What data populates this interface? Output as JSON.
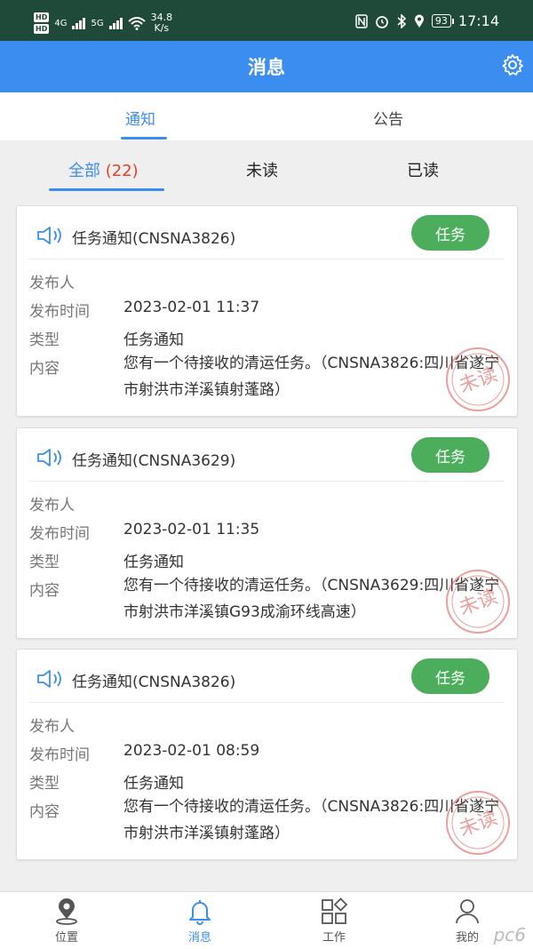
{
  "status_bar": {
    "hd1": "HD",
    "hd2": "HD",
    "net1": "4G",
    "net2": "5G",
    "speed_value": "34.8",
    "speed_unit": "K/s",
    "battery": "93",
    "time": "17:14"
  },
  "header": {
    "title": "消息",
    "settings_icon": "gear-icon"
  },
  "top_tabs": [
    {
      "label": "通知",
      "active": true
    },
    {
      "label": "公告",
      "active": false
    }
  ],
  "sub_tabs": {
    "all_label": "全部",
    "all_count": "(22)",
    "unread_label": "未读",
    "read_label": "已读"
  },
  "labels": {
    "publisher": "发布人",
    "publish_time": "发布时间",
    "type": "类型",
    "content": "内容"
  },
  "cards": [
    {
      "title": "任务通知(CNSNA3826)",
      "badge": "任务",
      "publisher": "",
      "time": "2023-02-01 11:37",
      "type": "任务通知",
      "content": "您有一个待接收的清运任务。（CNSNA3826:四川省遂宁市射洪市洋溪镇射蓬路）",
      "stamp": "未读"
    },
    {
      "title": "任务通知(CNSNA3629)",
      "badge": "任务",
      "publisher": "",
      "time": "2023-02-01 11:35",
      "type": "任务通知",
      "content": "您有一个待接收的清运任务。（CNSNA3629:四川省遂宁市射洪市洋溪镇G93成渝环线高速）",
      "stamp": "未读"
    },
    {
      "title": "任务通知(CNSNA3826)",
      "badge": "任务",
      "publisher": "",
      "time": "2023-02-01 08:59",
      "type": "任务通知",
      "content": "您有一个待接收的清运任务。（CNSNA3826:四川省遂宁市射洪市洋溪镇射蓬路）",
      "stamp": "未读"
    }
  ],
  "bottom_nav": [
    {
      "label": "位置",
      "icon": "location-pin-icon",
      "active": false
    },
    {
      "label": "消息",
      "icon": "bell-icon",
      "active": true
    },
    {
      "label": "工作",
      "icon": "grid-icon",
      "active": false
    },
    {
      "label": "我的",
      "icon": "user-icon",
      "active": false
    }
  ],
  "watermark": "pc6",
  "colors": {
    "primary": "#3b8ef0",
    "badge_green": "#4cae5c",
    "count_red": "#e0412f",
    "stamp_red": "#d9534f",
    "status_bar": "#1f4a3a"
  }
}
